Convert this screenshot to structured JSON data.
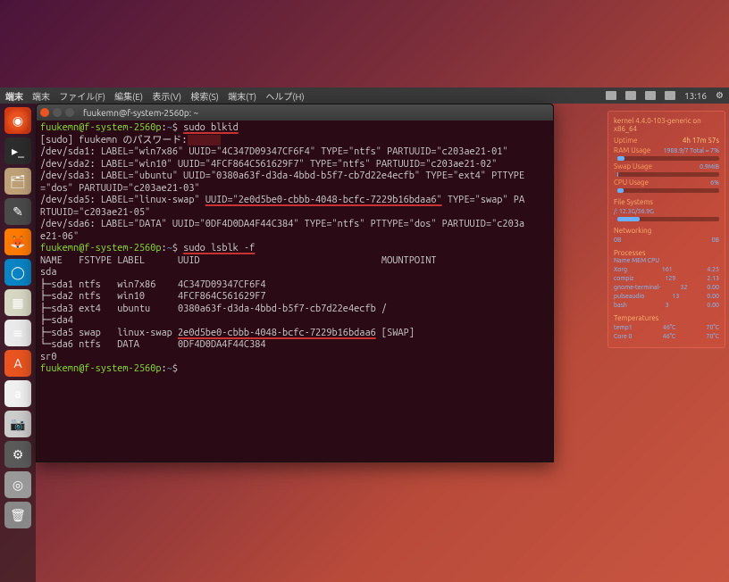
{
  "menubar": {
    "app": "端末",
    "menus": [
      "端末",
      "ファイル(F)",
      "編集(E)",
      "表示(V)",
      "検索(S)",
      "端末(T)",
      "ヘルプ(H)"
    ],
    "time": "13:16"
  },
  "launcher": {
    "items": [
      {
        "name": "ubuntu-icon"
      },
      {
        "name": "terminal-icon"
      },
      {
        "name": "files-icon"
      },
      {
        "name": "editor-icon"
      },
      {
        "name": "firefox-icon"
      },
      {
        "name": "chromium-icon"
      },
      {
        "name": "calc-icon"
      },
      {
        "name": "writer-icon"
      },
      {
        "name": "software-icon"
      },
      {
        "name": "amazon-icon",
        "glyph": "a"
      },
      {
        "name": "camera-icon"
      },
      {
        "name": "settings-icon"
      },
      {
        "name": "disc-icon"
      },
      {
        "name": "trash-icon"
      }
    ]
  },
  "terminal": {
    "title": "fuukemn@f-system-2560p: ~",
    "prompt_user": "fuukemn@f-system-2560p",
    "prompt_path": "~",
    "cmd1": "sudo blkid",
    "sudo_line": "[sudo] fuukemn のパスワード:",
    "blkid": [
      "/dev/sda1: LABEL=\"win7x86\" UUID=\"4C347D09347CF6F4\" TYPE=\"ntfs\" PARTUUID=\"c203ae21-01\"",
      "/dev/sda2: LABEL=\"win10\" UUID=\"4FCF864C561629F7\" TYPE=\"ntfs\" PARTUUID=\"c203ae21-02\"",
      "/dev/sda3: LABEL=\"ubuntu\" UUID=\"0380a63f-d3da-4bbd-b5f7-cb7d22e4ecfb\" TYPE=\"ext4\" PTTYPE=\"dos\" PARTUUID=\"c203ae21-03\"",
      "/dev/sda5: LABEL=\"linux-swap\" UUID=\"2e0d5be0-cbbb-4048-bcfc-7229b16bdaa6\" TYPE=\"swap\" PARTUUID=\"c203ae21-05\"",
      "/dev/sda6: LABEL=\"DATA\" UUID=\"0DF4D0DA4F44C384\" TYPE=\"ntfs\" PTTYPE=\"dos\" PARTUUID=\"c203ae21-06\""
    ],
    "cmd2": "sudo lsblk -f",
    "lsblk_header": "NAME   FSTYPE LABEL      UUID                                 MOUNTPOINT",
    "lsblk": [
      {
        "name": "sda",
        "fstype": "",
        "label": "",
        "uuid": "",
        "mnt": ""
      },
      {
        "name": "├─sda1",
        "fstype": "ntfs",
        "label": "win7x86",
        "uuid": "4C347D09347CF6F4",
        "mnt": ""
      },
      {
        "name": "├─sda2",
        "fstype": "ntfs",
        "label": "win10",
        "uuid": "4FCF864C561629F7",
        "mnt": ""
      },
      {
        "name": "├─sda3",
        "fstype": "ext4",
        "label": "ubuntu",
        "uuid": "0380a63f-d3da-4bbd-b5f7-cb7d22e4ecfb",
        "mnt": "/"
      },
      {
        "name": "├─sda4",
        "fstype": "",
        "label": "",
        "uuid": "",
        "mnt": ""
      },
      {
        "name": "├─sda5",
        "fstype": "swap",
        "label": "linux-swap",
        "uuid": "2e0d5be0-cbbb-4048-bcfc-7229b16bdaa6",
        "mnt": "[SWAP]"
      },
      {
        "name": "└─sda6",
        "fstype": "ntfs",
        "label": "DATA",
        "uuid": "0DF4D0DA4F44C384",
        "mnt": ""
      },
      {
        "name": "sr0",
        "fstype": "",
        "label": "",
        "uuid": "",
        "mnt": ""
      }
    ]
  },
  "widget": {
    "kernel": "kernel 4.4.0-103-generic on x86_64",
    "uptime_label": "Uptime",
    "uptime": "4h 17m 57s",
    "ram_label": "RAM Usage",
    "ram_text": "1988.9/7 Total = 7%",
    "ram_pct": 7,
    "swap_label": "Swap Usage",
    "swap_text": "0.9MiB",
    "swap_pct": 1,
    "cpu_label": "CPU Usage",
    "cpu_text": "6%",
    "cpu_pct": 6,
    "fs_header": "File Systems",
    "fs_path": "/: 12.3G/56.9G",
    "fs_pct": 22,
    "net_header": "Networking",
    "net_up": "0B",
    "net_down": "0B",
    "proc_header": "Processes",
    "proc_cols": "Name        MEM  CPU",
    "procs": [
      {
        "n": "Xorg",
        "m": "161",
        "c": "4.25"
      },
      {
        "n": "compiz",
        "m": "129",
        "c": "2.13"
      },
      {
        "n": "gnome-terminal-",
        "m": "32",
        "c": "0.00"
      },
      {
        "n": "pulseaudio",
        "m": "13",
        "c": "0.00"
      },
      {
        "n": "bash",
        "m": "3",
        "c": "0.00"
      }
    ],
    "temp_header": "Temperatures",
    "temp1_label": "temp1",
    "temp1": "46°C",
    "temp1b": "70°C",
    "core0_label": "Core 0",
    "core0": "46°C",
    "core0b": "70°C"
  }
}
